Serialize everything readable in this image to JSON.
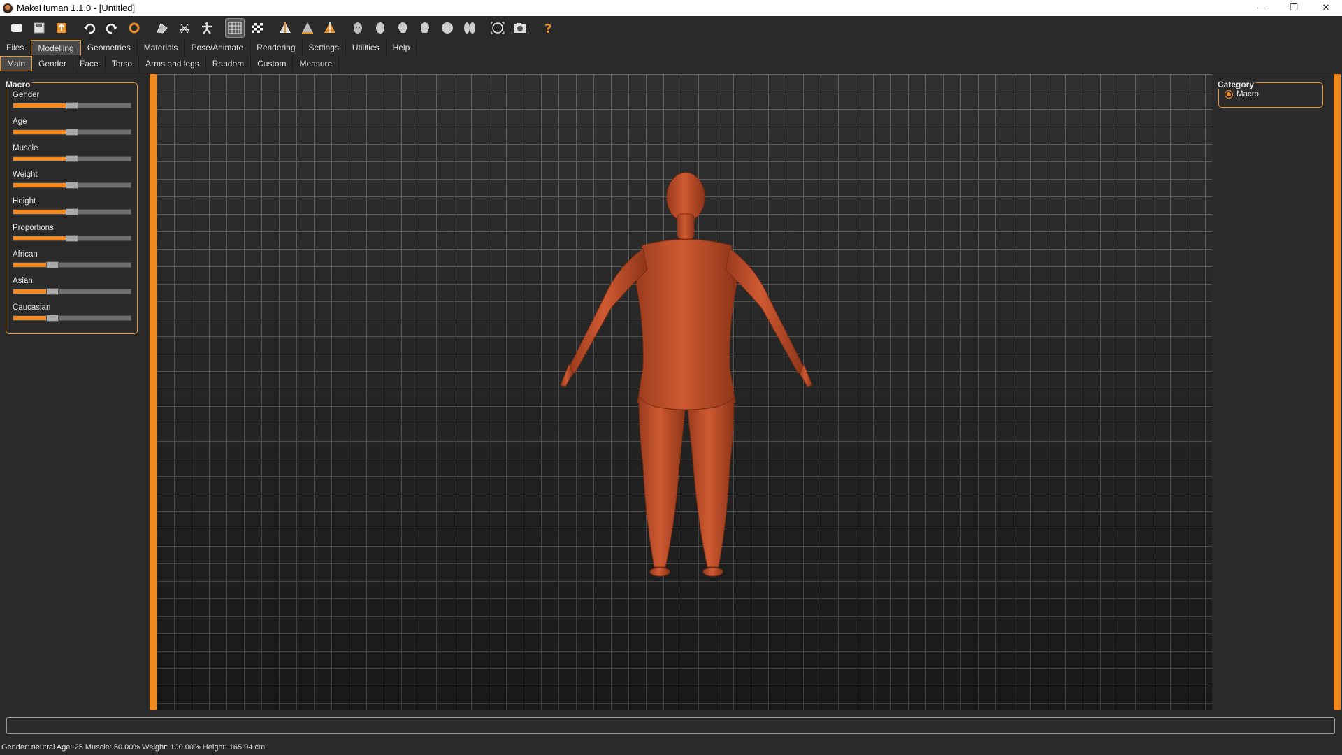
{
  "window": {
    "title": "MakeHuman 1.1.0 - [Untitled]",
    "minimize_icon": "minimize-icon",
    "maximize_icon": "restore-icon",
    "close_icon": "close-icon"
  },
  "toolbar": {
    "buttons": [
      {
        "icon": "new-file-icon"
      },
      {
        "icon": "save-icon"
      },
      {
        "icon": "export-icon"
      },
      {
        "icon": "undo-icon"
      },
      {
        "icon": "redo-icon"
      },
      {
        "icon": "reset-icon"
      },
      {
        "icon": "smooth-icon"
      },
      {
        "icon": "wireframe-icon"
      },
      {
        "icon": "pose-icon"
      },
      {
        "icon": "grid-icon",
        "active": true
      },
      {
        "icon": "checker-icon"
      },
      {
        "icon": "front-view-icon"
      },
      {
        "icon": "back-view-icon"
      },
      {
        "icon": "side-view-icon"
      },
      {
        "icon": "head-front-icon"
      },
      {
        "icon": "head-side-icon"
      },
      {
        "icon": "head-left-icon"
      },
      {
        "icon": "head-right-icon"
      },
      {
        "icon": "head-top-icon"
      },
      {
        "icon": "head-back-icon"
      },
      {
        "icon": "reset-camera-icon"
      },
      {
        "icon": "screenshot-icon"
      },
      {
        "icon": "help-icon"
      }
    ]
  },
  "main_tabs": [
    "Files",
    "Modelling",
    "Geometries",
    "Materials",
    "Pose/Animate",
    "Rendering",
    "Settings",
    "Utilities",
    "Help"
  ],
  "main_tab_active": "Modelling",
  "sub_tabs": [
    "Main",
    "Gender",
    "Face",
    "Torso",
    "Arms and legs",
    "Random",
    "Custom",
    "Measure"
  ],
  "sub_tab_active": "Main",
  "left_panel": {
    "title": "Macro",
    "sliders": [
      {
        "label": "Gender",
        "value": 0.5
      },
      {
        "label": "Age",
        "value": 0.5
      },
      {
        "label": "Muscle",
        "value": 0.5
      },
      {
        "label": "Weight",
        "value": 0.5
      },
      {
        "label": "Height",
        "value": 0.5
      },
      {
        "label": "Proportions",
        "value": 0.5
      },
      {
        "label": "African",
        "value": 0.333
      },
      {
        "label": "Asian",
        "value": 0.333
      },
      {
        "label": "Caucasian",
        "value": 0.333
      }
    ]
  },
  "right_panel": {
    "title": "Category",
    "option": "Macro"
  },
  "status": "Gender: neutral Age: 25 Muscle: 50.00% Weight: 100.00% Height: 165.94 cm",
  "colors": {
    "accent": "#f08a20",
    "background": "#2b2b2b",
    "skin": "#c0502a"
  }
}
